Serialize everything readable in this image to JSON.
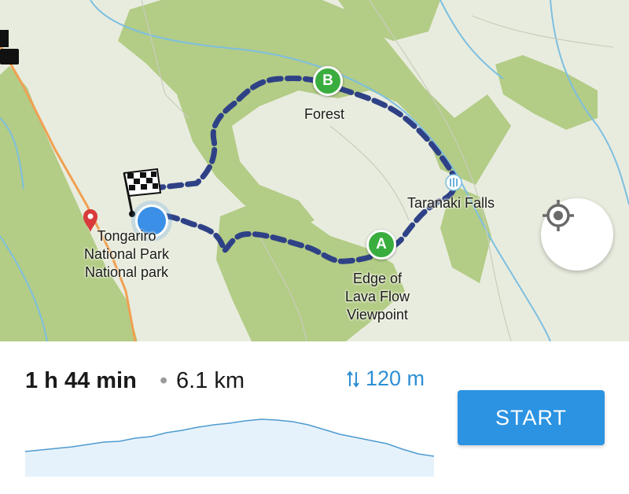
{
  "map": {
    "labels": {
      "forest": "Forest",
      "falls": "Taranaki Falls",
      "park_line1": "Tongariro",
      "park_line2": "National Park",
      "park_line3": "National park",
      "viewpoint_line1": "Edge of",
      "viewpoint_line2": "Lava Flow",
      "viewpoint_line3": "Viewpoint"
    },
    "waypoints": {
      "a": "A",
      "b": "B"
    },
    "icons": {
      "finish": "checkered-flag-icon",
      "current_location": "location-dot-icon",
      "poi": "red-pin-icon",
      "waterfall": "waterfall-icon",
      "locate": "crosshair-icon"
    },
    "colors": {
      "route": "#2f4186",
      "forest": "#b3cc86",
      "waypoint": "#3aad3f",
      "current_location": "#3b8fe6",
      "road": "#f0a052",
      "river": "#7dbfe0"
    }
  },
  "summary": {
    "duration": "1 h 44 min",
    "separator": "•",
    "distance": "6.1 km",
    "elevation_gain": "120 m",
    "elevation_icon": "up-down-arrows-icon"
  },
  "start_label": "START",
  "colors": {
    "accent": "#2b93e2",
    "elevation_text": "#2e8fd3"
  }
}
